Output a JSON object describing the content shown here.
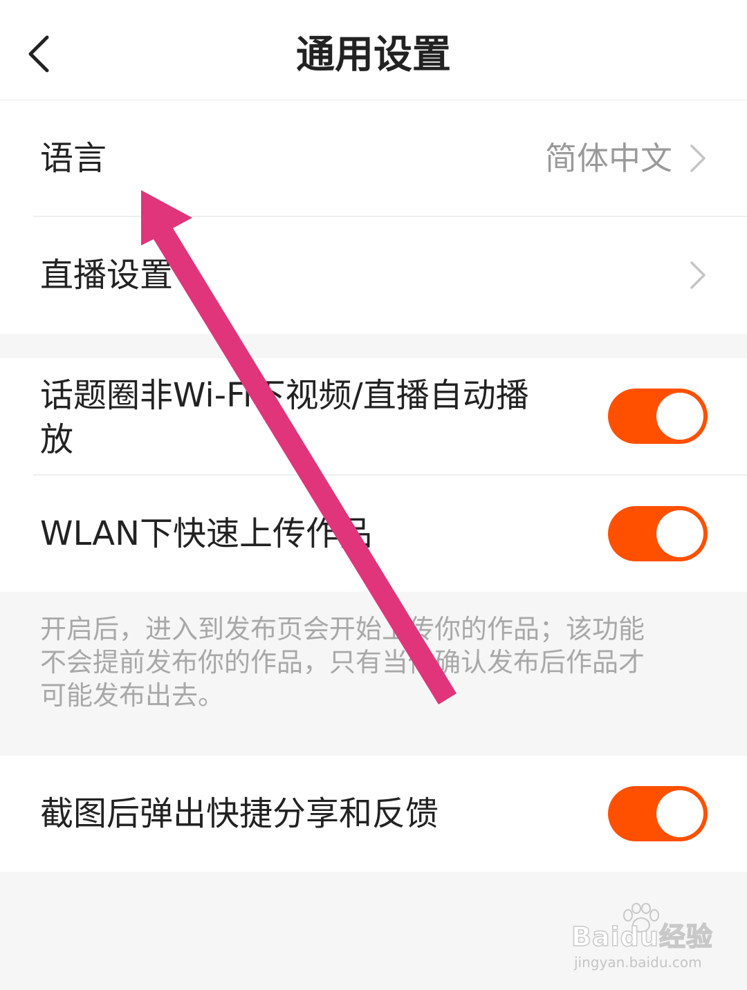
{
  "header": {
    "title": "通用设置",
    "back_icon": "chevron-left-icon"
  },
  "rows": {
    "language": {
      "label": "语言",
      "value": "简体中文"
    },
    "live": {
      "label": "直播设置"
    },
    "autoplay": {
      "label_line1": "话题圈非Wi-Fi下视频/直播自动播",
      "label_line2": "放",
      "enabled": true
    },
    "wlan_upload": {
      "label": "WLAN下快速上传作品",
      "enabled": true
    },
    "screenshot_share": {
      "label": "截图后弹出快捷分享和反馈",
      "enabled": true
    }
  },
  "wlan_note": {
    "line1": "开启后，进入到发布页会开始上传你的作品；该功能",
    "line2": "不会提前发布你的作品，只有当你确认发布后作品才",
    "line3": "可能发布出去。"
  },
  "watermark": {
    "brand": "Baidu经验",
    "url": "jingyan.baidu.com"
  },
  "colors": {
    "toggle_on": "#ff5000",
    "annotation_arrow": "#e0357a",
    "background": "#f6f6f6"
  }
}
